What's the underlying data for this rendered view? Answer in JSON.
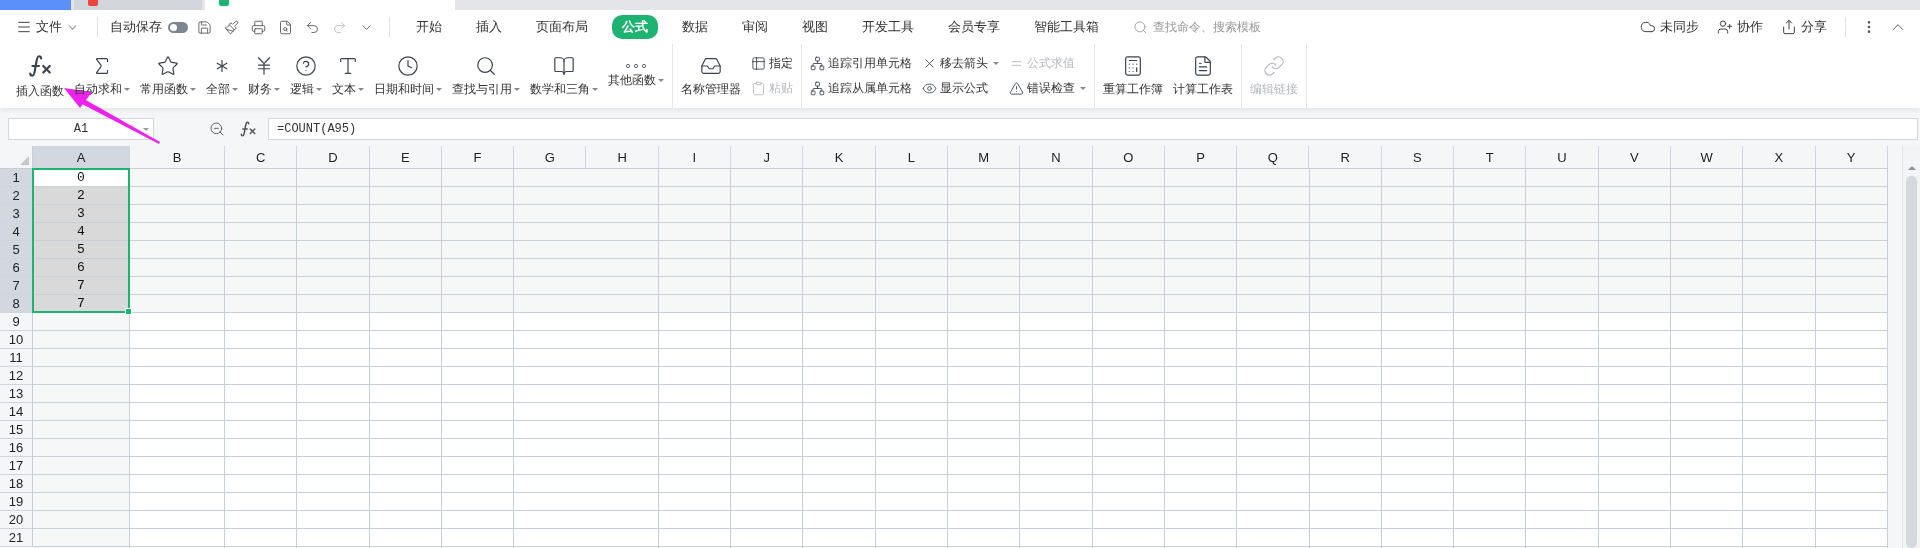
{
  "menu_bar": {
    "file_menu": "文件",
    "autosave": {
      "label": "自动保存",
      "on": false
    },
    "tabs": [
      {
        "label": "开始",
        "selected": false
      },
      {
        "label": "插入",
        "selected": false
      },
      {
        "label": "页面布局",
        "selected": false
      },
      {
        "label": "公式",
        "selected": true
      },
      {
        "label": "数据",
        "selected": false
      },
      {
        "label": "审阅",
        "selected": false
      },
      {
        "label": "视图",
        "selected": false
      },
      {
        "label": "开发工具",
        "selected": false
      },
      {
        "label": "会员专享",
        "selected": false
      },
      {
        "label": "智能工具箱",
        "selected": false
      }
    ],
    "search": {
      "placeholder": "查找命令、搜索模板"
    },
    "actions": [
      "未同步",
      "协作",
      "分享"
    ]
  },
  "ribbon": {
    "groups": [
      {
        "items": [
          {
            "kind": "big",
            "label": "插入函数",
            "dropdown": false,
            "disabled": false
          },
          {
            "kind": "big",
            "label": "自动求和",
            "dropdown": true,
            "disabled": false
          },
          {
            "kind": "big",
            "label": "常用函数",
            "dropdown": true,
            "disabled": false
          },
          {
            "kind": "big",
            "label": "全部",
            "dropdown": true,
            "disabled": false
          },
          {
            "kind": "big",
            "label": "财务",
            "dropdown": true,
            "disabled": false
          },
          {
            "kind": "big",
            "label": "逻辑",
            "dropdown": true,
            "disabled": false
          },
          {
            "kind": "big",
            "label": "文本",
            "dropdown": true,
            "disabled": false
          },
          {
            "kind": "big",
            "label": "日期和时间",
            "dropdown": true,
            "disabled": false
          },
          {
            "kind": "big",
            "label": "查找与引用",
            "dropdown": true,
            "disabled": false
          },
          {
            "kind": "big",
            "label": "数学和三角",
            "dropdown": true,
            "disabled": false
          },
          {
            "kind": "big",
            "label": "其他函数",
            "dropdown": true,
            "disabled": false
          }
        ]
      },
      {
        "items": [
          {
            "kind": "big",
            "label": "名称管理器",
            "dropdown": false,
            "disabled": false
          },
          {
            "kind": "small",
            "label": "指定",
            "dropdown": false,
            "disabled": false
          },
          {
            "kind": "small",
            "label": "粘贴",
            "dropdown": false,
            "disabled": true
          }
        ]
      },
      {
        "items": [
          {
            "kind": "small",
            "label": "追踪引用单元格",
            "dropdown": false,
            "disabled": false
          },
          {
            "kind": "small",
            "label": "追踪从属单元格",
            "dropdown": false,
            "disabled": false
          },
          {
            "kind": "small",
            "label": "移去箭头",
            "dropdown": true,
            "disabled": false
          },
          {
            "kind": "small",
            "label": "显示公式",
            "dropdown": false,
            "disabled": false
          },
          {
            "kind": "small",
            "label": "公式求值",
            "dropdown": false,
            "disabled": true
          },
          {
            "kind": "small",
            "label": "错误检查",
            "dropdown": true,
            "disabled": false
          }
        ]
      },
      {
        "items": [
          {
            "kind": "big",
            "label": "重算工作簿",
            "dropdown": false,
            "disabled": false
          },
          {
            "kind": "big",
            "label": "计算工作表",
            "dropdown": false,
            "disabled": false
          }
        ]
      },
      {
        "items": [
          {
            "kind": "big",
            "label": "编辑链接",
            "dropdown": false,
            "disabled": true
          }
        ]
      }
    ]
  },
  "formula_bar": {
    "name_box": "A1",
    "formula": "=COUNT(A95)"
  },
  "sheet": {
    "columns": [
      {
        "label": "A",
        "selected": true
      },
      {
        "label": "B",
        "selected": false
      },
      {
        "label": "C",
        "selected": false
      },
      {
        "label": "D",
        "selected": false
      },
      {
        "label": "E",
        "selected": false
      },
      {
        "label": "F",
        "selected": false
      },
      {
        "label": "G",
        "selected": false
      },
      {
        "label": "H",
        "selected": false
      },
      {
        "label": "I",
        "selected": false
      },
      {
        "label": "J",
        "selected": false
      },
      {
        "label": "K",
        "selected": false
      },
      {
        "label": "L",
        "selected": false
      },
      {
        "label": "M",
        "selected": false
      },
      {
        "label": "N",
        "selected": false
      },
      {
        "label": "O",
        "selected": false
      },
      {
        "label": "P",
        "selected": false
      },
      {
        "label": "Q",
        "selected": false
      },
      {
        "label": "R",
        "selected": false
      },
      {
        "label": "S",
        "selected": false
      },
      {
        "label": "T",
        "selected": false
      },
      {
        "label": "U",
        "selected": false
      },
      {
        "label": "V",
        "selected": false
      },
      {
        "label": "W",
        "selected": false
      },
      {
        "label": "X",
        "selected": false
      },
      {
        "label": "Y",
        "selected": false
      }
    ],
    "rows": [
      {
        "header": "1",
        "selected": true,
        "cells": [
          {
            "value": "0",
            "active": true
          }
        ]
      },
      {
        "header": "2",
        "selected": true,
        "cells": [
          {
            "value": "2",
            "active": false
          }
        ]
      },
      {
        "header": "3",
        "selected": true,
        "cells": [
          {
            "value": "3",
            "active": false
          }
        ]
      },
      {
        "header": "4",
        "selected": true,
        "cells": [
          {
            "value": "4",
            "active": false
          }
        ]
      },
      {
        "header": "5",
        "selected": true,
        "cells": [
          {
            "value": "5",
            "active": false
          }
        ]
      },
      {
        "header": "6",
        "selected": true,
        "cells": [
          {
            "value": "6",
            "active": false
          }
        ]
      },
      {
        "header": "7",
        "selected": true,
        "cells": [
          {
            "value": "7",
            "active": false
          }
        ]
      },
      {
        "header": "8",
        "selected": true,
        "cells": [
          {
            "value": "7",
            "active": false
          }
        ]
      },
      {
        "header": "9",
        "selected": false
      },
      {
        "header": "10",
        "selected": false
      },
      {
        "header": "11",
        "selected": false
      },
      {
        "header": "12",
        "selected": false
      },
      {
        "header": "13",
        "selected": false
      },
      {
        "header": "14",
        "selected": false
      },
      {
        "header": "15",
        "selected": false
      },
      {
        "header": "16",
        "selected": false
      },
      {
        "header": "17",
        "selected": false
      },
      {
        "header": "18",
        "selected": false
      },
      {
        "header": "19",
        "selected": false
      },
      {
        "header": "20",
        "selected": false
      },
      {
        "header": "21",
        "selected": false
      }
    ]
  }
}
